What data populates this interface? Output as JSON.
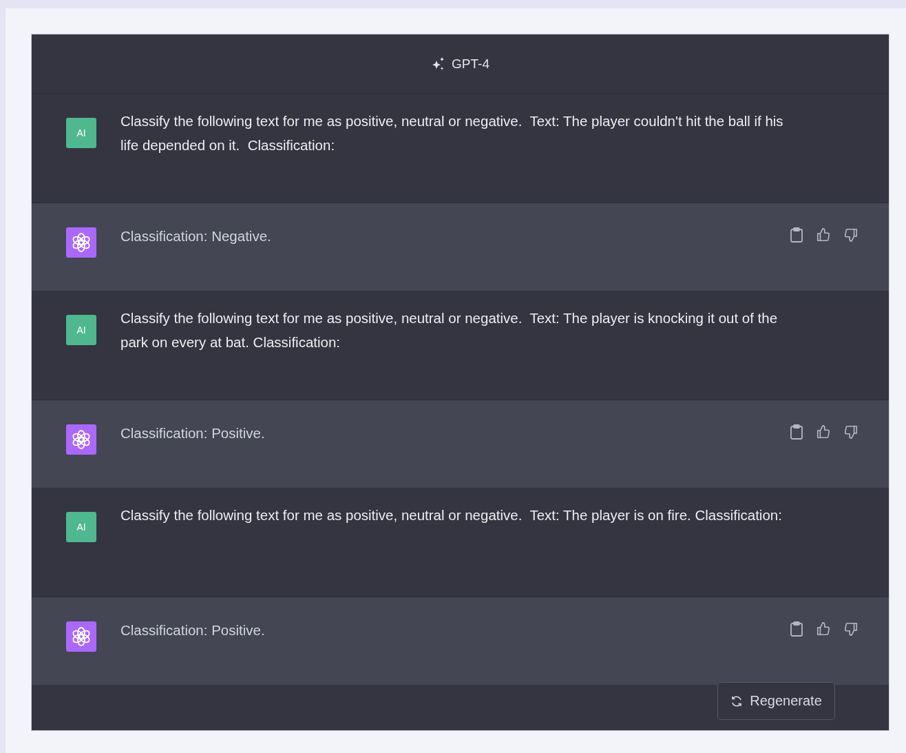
{
  "header": {
    "model": "GPT-4"
  },
  "messages": [
    {
      "kind": "user",
      "avatar": "AI",
      "text": "Classify the following text for me as positive, neutral or negative.  Text: The player couldn't hit the ball if his life depended on it.  Classification:"
    },
    {
      "kind": "assistant",
      "text": "Classification: Negative."
    },
    {
      "kind": "user",
      "avatar": "AI",
      "text": "Classify the following text for me as positive, neutral or negative.  Text: The player is knocking it out of the park on every at bat. Classification:"
    },
    {
      "kind": "assistant",
      "text": "Classification: Positive."
    },
    {
      "kind": "user",
      "avatar": "AI",
      "text": "Classify the following text for me as positive, neutral or negative.  Text: The player is on fire. Classification:"
    },
    {
      "kind": "assistant",
      "text": "Classification: Positive."
    }
  ],
  "footer": {
    "button": "Regenerate"
  }
}
